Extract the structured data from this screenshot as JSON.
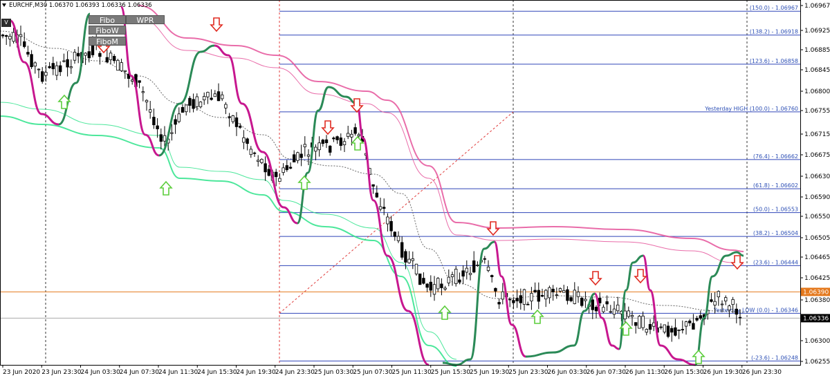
{
  "header": {
    "title": "EURCHF,M30 1.06370 1.06393 1.06336 1.06336"
  },
  "buttons": {
    "fibo": "Fibo",
    "wpr": "WPR",
    "fibow": "FiboW",
    "fibom": "FiboM"
  },
  "v_icon": "V",
  "colors": {
    "bull_candle": "#ffffff",
    "bear_candle": "#000000",
    "fibo_line": "#2f45b8",
    "fibo_text": "#2c4fb5",
    "orange_line": "#e4781c",
    "pink_channel": "#e5529a",
    "green_channel": "#2de38a",
    "oscillator_up": "#2b8a57",
    "oscillator_down": "#c7178f",
    "up_arrow": "#5ccd3c",
    "down_arrow": "#e02a20"
  },
  "chart_data": {
    "type": "candlestick",
    "symbol": "EURCHF",
    "timeframe": "M30",
    "ylim": [
      1.0624,
      1.0699
    ],
    "price_axis_ticks": [
      "1.06967",
      "1.06925",
      "1.06885",
      "1.06845",
      "1.06800",
      "1.06755",
      "1.06715",
      "1.06675",
      "1.06630",
      "1.06590",
      "1.06550",
      "1.06505",
      "1.06465",
      "1.06425",
      "1.06380",
      "1.06340",
      "1.06300",
      "1.06255"
    ],
    "time_axis_ticks": [
      "23 Jun 2020",
      "23 Jun 23:30",
      "24 Jun 03:30",
      "24 Jun 07:30",
      "24 Jun 11:30",
      "24 Jun 15:30",
      "24 Jun 19:30",
      "24 Jun 23:30",
      "25 Jun 03:30",
      "25 Jun 07:30",
      "25 Jun 11:30",
      "25 Jun 15:30",
      "25 Jun 19:30",
      "25 Jun 23:30",
      "26 Jun 03:30",
      "26 Jun 07:30",
      "26 Jun 11:30",
      "26 Jun 15:30",
      "26 Jun 19:30",
      "26 Jun 23:30"
    ],
    "fibo_levels": [
      {
        "label": "(150.0) - 1.06967",
        "price": 1.06967
      },
      {
        "label": "(138.2) - 1.06918",
        "price": 1.06918
      },
      {
        "label": "(123.6) - 1.06858",
        "price": 1.06858
      },
      {
        "label": "Yesterday HIGH (100.0) - 1.06760",
        "price": 1.0676
      },
      {
        "label": "(76.4) - 1.06662",
        "price": 1.06662
      },
      {
        "label": "(61.8) - 1.06602",
        "price": 1.06602
      },
      {
        "label": "(50.0) - 1.06553",
        "price": 1.06553
      },
      {
        "label": "(38.2) - 1.06504",
        "price": 1.06504
      },
      {
        "label": "(23.6) - 1.06444",
        "price": 1.06444
      },
      {
        "label": "Yesterday LOW (0.0) - 1.06346",
        "price": 1.06346
      },
      {
        "label": "(-23.6) - 1.06248",
        "price": 1.06248
      }
    ],
    "current_price_labels": [
      {
        "label": "1.06390",
        "price": 1.0639,
        "color": "#e4781c"
      },
      {
        "label": "1.06336",
        "price": 1.06336,
        "color": "#000000"
      }
    ]
  }
}
